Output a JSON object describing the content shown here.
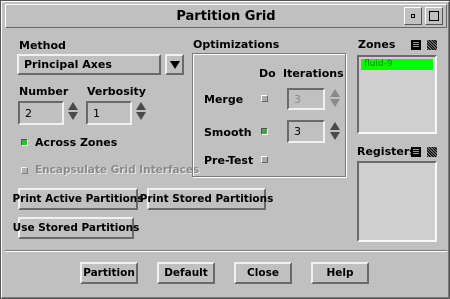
{
  "window": {
    "title": "Partition Grid"
  },
  "method": {
    "label": "Method",
    "value": "Principal Axes"
  },
  "number": {
    "label": "Number",
    "value": "2"
  },
  "verbosity": {
    "label": "Verbosity",
    "value": "1"
  },
  "across_zones": {
    "label": "Across Zones",
    "checked": true
  },
  "encapsulate": {
    "label": "Encapsulate Grid Interfaces",
    "checked": false,
    "enabled": false
  },
  "optimizations": {
    "title": "Optimizations",
    "col_do": "Do",
    "col_iterations": "Iterations",
    "rows": [
      {
        "label": "Merge",
        "do": false,
        "iterations": "3",
        "enabled": false
      },
      {
        "label": "Smooth",
        "do": true,
        "iterations": "3",
        "enabled": true
      },
      {
        "label": "Pre-Test",
        "do": false
      }
    ]
  },
  "zones": {
    "title": "Zones",
    "items": [
      "fluid-9"
    ],
    "selected": 0
  },
  "registers": {
    "title": "Registers",
    "items": []
  },
  "buttons": {
    "print_active": "Print Active Partitions",
    "print_stored": "Print Stored Partitions",
    "use_stored": "Use Stored Partitions",
    "partition": "Partition",
    "default": "Default",
    "close": "Close",
    "help": "Help"
  },
  "colors": {
    "check_on": "#1ec81e",
    "selection": "#00ff00",
    "panel": "#c0c0c0"
  }
}
